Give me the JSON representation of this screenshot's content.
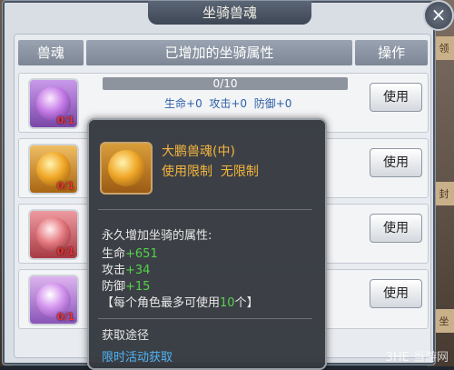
{
  "window": {
    "title": "坐骑兽魂",
    "close_glyph": "×"
  },
  "side_tags": [
    "领",
    "封",
    "坐"
  ],
  "table": {
    "headers": [
      "兽魂",
      "已增加的坐骑属性",
      "操作"
    ],
    "rows": [
      {
        "icon": "purple-phoenix-soul-icon",
        "color": "#b07ad8",
        "count": "0/1",
        "progress": "0/10",
        "stats": [
          "生命",
          "+0",
          "攻击",
          "+0",
          "防御",
          "+0"
        ],
        "button": "使用"
      },
      {
        "icon": "gold-phoenix-soul-icon",
        "color": "#e3a23a",
        "count": "0/1",
        "button": "使用"
      },
      {
        "icon": "red-phoenix-soul-icon",
        "color": "#d9646a",
        "count": "0/1",
        "button": "使用"
      },
      {
        "icon": "violet-orb-soul-icon",
        "color": "#c68be0",
        "count": "0/1",
        "button": "使用"
      }
    ]
  },
  "tooltip": {
    "name": "大鹏兽魂(中)",
    "limit_label": "使用限制",
    "limit_value": "无限制",
    "desc": "永久增加坐骑的属性:",
    "hp_label": "生命",
    "hp_value": "+651",
    "atk_label": "攻击",
    "atk_value": "+34",
    "def_label": "防御",
    "def_value": "+15",
    "note_prefix": "【每个角色最多可使用",
    "note_count": "10",
    "note_suffix": "个】",
    "source_header": "获取途径",
    "source_link": "限时活动获取"
  },
  "watermark": "3HE 当游网"
}
